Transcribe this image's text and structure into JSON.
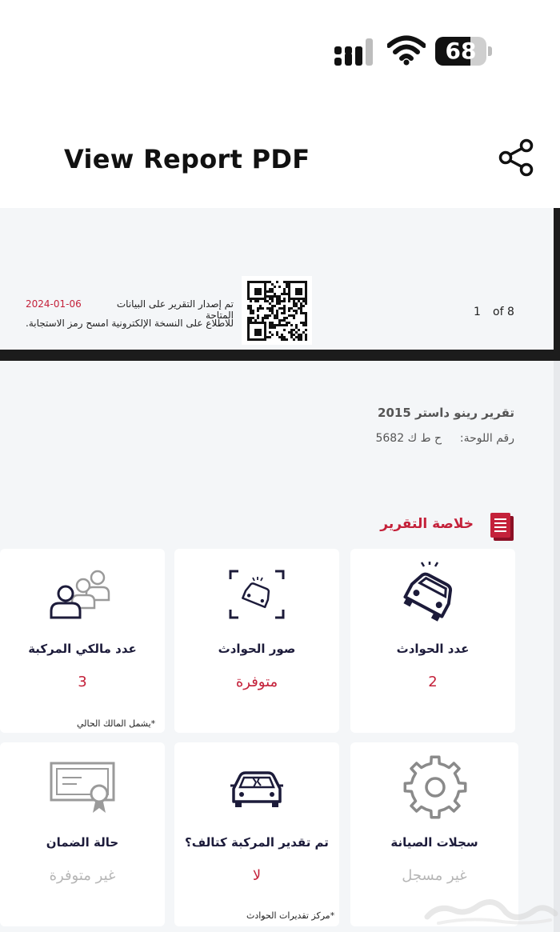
{
  "status_bar": {
    "battery_percent": "68",
    "battery_level": 0.68,
    "signal_icon": "cellular-signal-icon",
    "wifi_icon": "wifi-icon"
  },
  "header": {
    "title": "View Report PDF",
    "share_icon": "share-icon"
  },
  "page_one": {
    "issue_text": "تم إصدار التقرير على البيانات المتاحة",
    "issue_date": "2024-01-06",
    "scan_text": "للاطلاع على النسخة الإلكترونية امسح رمز الاستجابة.",
    "page_number": "1",
    "page_total": "of 8"
  },
  "report": {
    "title": "تقرير رينو داستر 2015",
    "plate_label": "رقم اللوحة:",
    "plate_value": "ح ط ك 5682",
    "summary_heading": "خلاصة التقرير"
  },
  "cards": {
    "accidents_count": {
      "label": "عدد الحوادث",
      "value": "2",
      "icon": "crashed-car-icon"
    },
    "accident_photos": {
      "label": "صور الحوادث",
      "value": "متوفرة",
      "icon": "car-photo-icon"
    },
    "owners_count": {
      "label": "عدد مالكي المركبة",
      "value": "3",
      "note": "*يشمل المالك الحالي",
      "icon": "owners-icon"
    },
    "maintenance": {
      "label": "سجلات الصيانة",
      "value": "غير مسجل",
      "icon": "gear-icon"
    },
    "total_loss": {
      "label": "تم تقدير المركبة كتالف؟",
      "value": "لا",
      "note": "*مركز تقديرات الحوادث",
      "icon": "damaged-car-icon"
    },
    "warranty": {
      "label": "حالة الضمان",
      "value": "غير متوفرة",
      "icon": "certificate-icon"
    }
  },
  "colors": {
    "accent_red": "#c4213a",
    "navy": "#1c1b3a",
    "muted": "#b6b6b6"
  }
}
